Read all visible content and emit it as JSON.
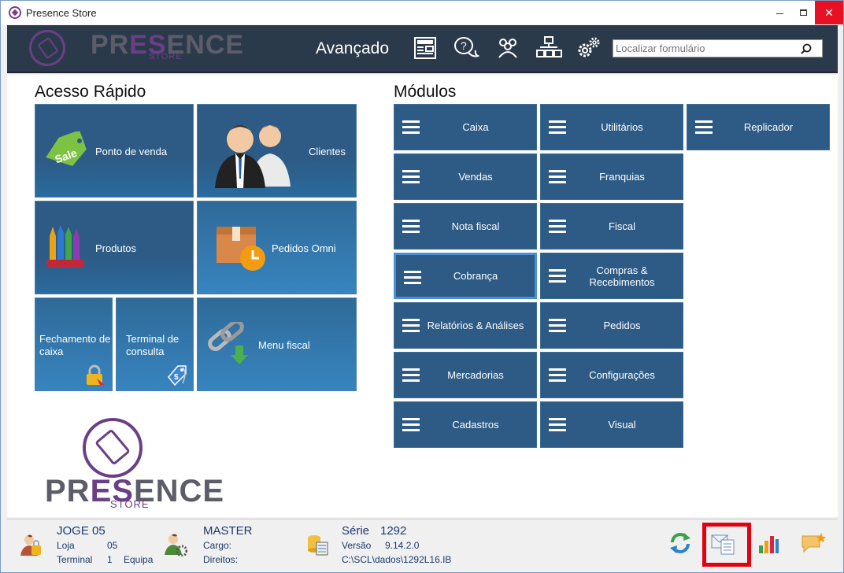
{
  "window": {
    "title": "Presence Store",
    "minimize": "",
    "maximize": "",
    "close": "✕"
  },
  "header": {
    "logo_word_a": "PR",
    "logo_word_b": "ES",
    "logo_word_c": "ENCE",
    "logo_sub": "STORE",
    "title": "Avançado",
    "icons": [
      "news-icon",
      "help-chat-icon",
      "users-group-icon",
      "network-icon",
      "settings-gears-icon"
    ],
    "search_placeholder": "Localizar formulário",
    "search_value": ""
  },
  "quick_access": {
    "title": "Acesso Rápido",
    "tiles": [
      {
        "label": "Ponto de venda",
        "icon": "sale-tag-icon"
      },
      {
        "label": "Clientes",
        "icon": "customers-icon"
      },
      {
        "label": "Produtos",
        "icon": "crayons-icon"
      },
      {
        "label": "Pedidos Omni",
        "icon": "box-clock-icon"
      },
      {
        "label": "Fechamento de caixa",
        "icon": "padlock-icon"
      },
      {
        "label": "Terminal de consulta",
        "icon": "price-tag-icon"
      },
      {
        "label": "Menu fiscal",
        "icon": "chain-link-icon"
      }
    ]
  },
  "modules": {
    "title": "Módulos",
    "col1": [
      "Caixa",
      "Vendas",
      "Nota fiscal",
      "Cobrança",
      "Relatórios & Análises",
      "Mercadorias",
      "Cadastros"
    ],
    "col2": [
      "Utilitários",
      "Franquias",
      "Fiscal",
      "Compras & Recebimentos",
      "Pedidos",
      "Configurações",
      "Visual"
    ],
    "col3": [
      "Replicador"
    ],
    "active": "Cobrança"
  },
  "footer_logo": {
    "word_a": "PR",
    "word_b": "ES",
    "word_c": "ENCE",
    "sub": "STORE"
  },
  "status": {
    "user_name": "JOGE 05",
    "loja_label": "Loja",
    "loja_value": "05",
    "terminal_label": "Terminal",
    "terminal_value": "1",
    "equipa_label": "Equipa",
    "role": "MASTER",
    "cargo_label": "Cargo:",
    "direitos_label": "Direitos:",
    "serie_label": "Série",
    "serie_value": "1292",
    "versao_label": "Versão",
    "versao_value": "9.14.2.0",
    "path": "C:\\SCL\\dados\\1292L16.IB"
  },
  "colors": {
    "tile_blue": "#2d5b85",
    "header_dark": "#2b3a4a",
    "brand_purple": "#6b3f86",
    "highlight_red": "#e3000f"
  }
}
